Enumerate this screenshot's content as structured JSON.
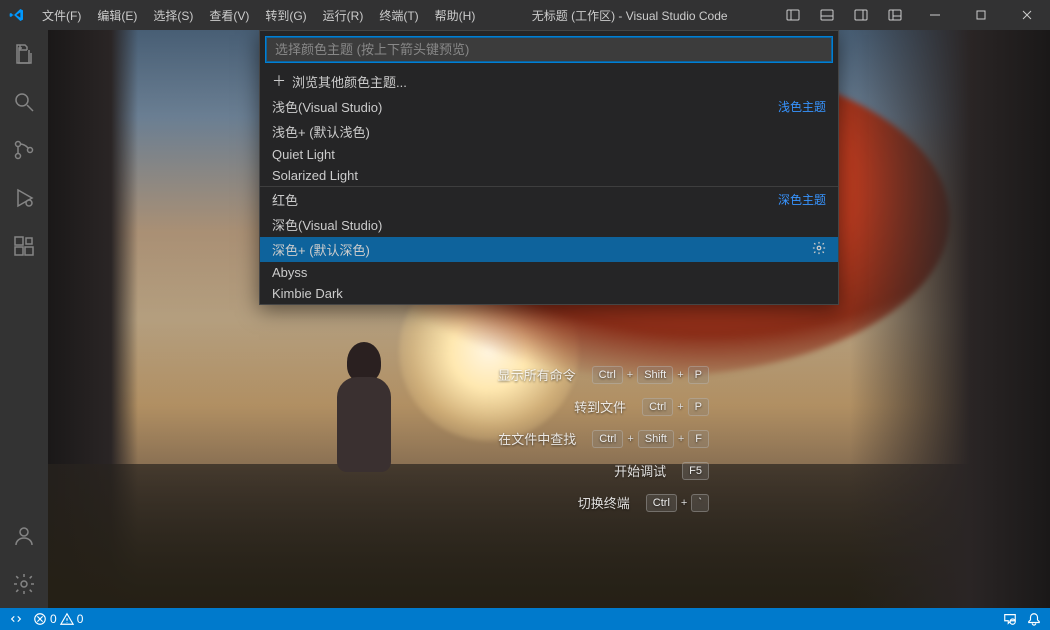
{
  "title": "无标题 (工作区) - Visual Studio Code",
  "menu": [
    {
      "label": "文件(F)"
    },
    {
      "label": "编辑(E)"
    },
    {
      "label": "选择(S)"
    },
    {
      "label": "查看(V)"
    },
    {
      "label": "转到(G)"
    },
    {
      "label": "运行(R)"
    },
    {
      "label": "终端(T)"
    },
    {
      "label": "帮助(H)"
    }
  ],
  "quickPick": {
    "placeholder": "选择颜色主题 (按上下箭头键预览)",
    "browseLabel": "浏览其他颜色主题...",
    "lightHeader": "浅色主题",
    "darkHeader": "深色主题",
    "items": [
      {
        "label": "浅色(Visual Studio)",
        "badge": "浅色主题",
        "sep": false
      },
      {
        "label": "浅色+ (默认浅色)",
        "sep": false
      },
      {
        "label": "Quiet Light",
        "sep": false
      },
      {
        "label": "Solarized Light",
        "sep": false
      },
      {
        "label": "红色",
        "badge": "深色主题",
        "sep": true
      },
      {
        "label": "深色(Visual Studio)",
        "sep": false
      },
      {
        "label": "深色+ (默认深色)",
        "sep": false,
        "selected": true
      },
      {
        "label": "Abyss",
        "sep": false
      },
      {
        "label": "Kimbie Dark",
        "sep": false
      }
    ]
  },
  "shortcuts": [
    {
      "label": "显示所有命令",
      "keys": [
        "Ctrl",
        "Shift",
        "P"
      ]
    },
    {
      "label": "转到文件",
      "keys": [
        "Ctrl",
        "P"
      ]
    },
    {
      "label": "在文件中查找",
      "keys": [
        "Ctrl",
        "Shift",
        "F"
      ]
    },
    {
      "label": "开始调试",
      "keys": [
        "F5"
      ]
    },
    {
      "label": "切换终端",
      "keys": [
        "Ctrl",
        "`"
      ]
    }
  ],
  "status": {
    "errors": "0",
    "warnings": "0"
  }
}
